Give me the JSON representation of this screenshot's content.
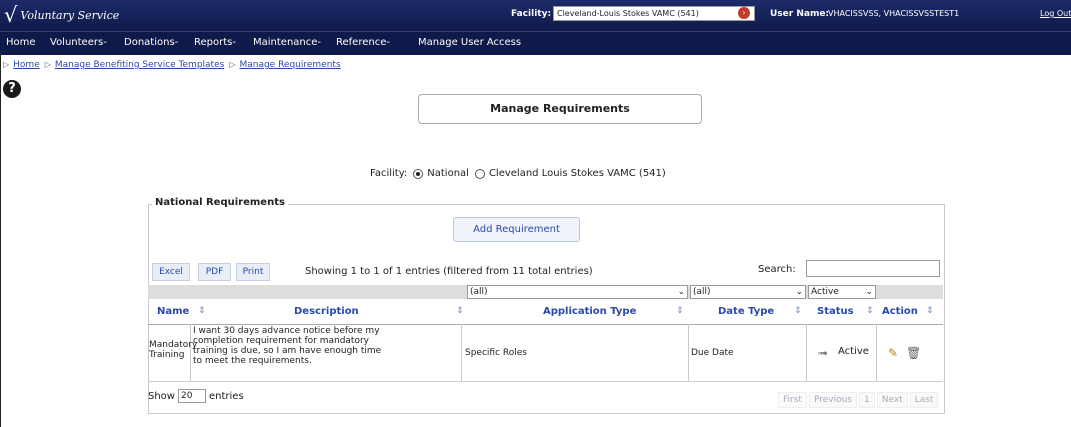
{
  "header": {
    "app_name": "Voluntary Service",
    "facility_label": "Facility:",
    "facility_value": "Cleveland-Louis Stokes VAMC (541)",
    "user_label": "User Name:",
    "user_value": "VHACISSVSS, VHACISSVSSTEST1",
    "logout_label": "Log Out"
  },
  "nav": {
    "items": [
      "Home",
      "Volunteers",
      "Donations",
      "Reports",
      "Maintenance",
      "Reference",
      "Manage User Access"
    ],
    "dropdown_marker": "-"
  },
  "breadcrumb": {
    "sep": "▷",
    "items": [
      "Home",
      "Manage Benefiting Service Templates",
      "Manage Requirements"
    ]
  },
  "page": {
    "title": "Manage Requirements",
    "facility_label": "Facility:",
    "facility_options": [
      "National",
      "Cleveland Louis Stokes VAMC (541)"
    ],
    "facility_selected": "National"
  },
  "requirements": {
    "legend": "National Requirements",
    "add_button": "Add Requirement",
    "export_buttons": [
      "Excel",
      "PDF",
      "Print"
    ],
    "showing_text": "Showing 1 to 1 of 1 entries (filtered from 11 total entries)",
    "search_label": "Search:",
    "search_value": "",
    "filters": {
      "application_type": "(all)",
      "date_type": "(all)",
      "status": "Active"
    },
    "columns": [
      "Name",
      "Description",
      "Application Type",
      "Date Type",
      "Status",
      "Action"
    ],
    "rows": [
      {
        "name_line1": "Mandatory",
        "name_line2": "Training",
        "description": [
          "I want 30 days advance notice before my",
          "completion requirement for mandatory",
          "training is due, so I am have enough time",
          "to meet the requirements."
        ],
        "application_type": "Specific Roles",
        "date_type": "Due Date",
        "status": "Active"
      }
    ],
    "show_label": "Show",
    "page_length": "20",
    "entries_label": "entries",
    "pager": [
      "First",
      "Previous",
      "1",
      "Next",
      "Last"
    ]
  }
}
